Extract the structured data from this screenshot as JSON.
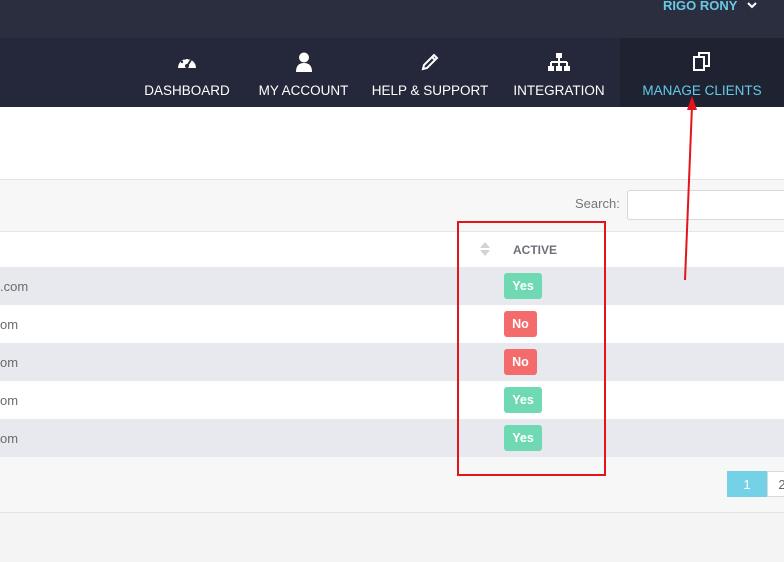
{
  "topbar": {
    "user_name": "RIGO RONY"
  },
  "nav": {
    "items": [
      {
        "label": "DASHBOARD",
        "icon": "speedometer-icon"
      },
      {
        "label": "MY ACCOUNT",
        "icon": "user-icon"
      },
      {
        "label": "HELP & SUPPORT",
        "icon": "pencil-icon"
      },
      {
        "label": "INTEGRATION",
        "icon": "sitemap-icon"
      },
      {
        "label": "MANAGE CLIENTS",
        "icon": "copy-icon",
        "active": true
      }
    ]
  },
  "search": {
    "label": "Search:",
    "value": ""
  },
  "table": {
    "columns": {
      "active": "ACTIVE"
    },
    "rows": [
      {
        "email": ".com",
        "active": "Yes"
      },
      {
        "email": "om",
        "active": "No"
      },
      {
        "email": "om",
        "active": "No"
      },
      {
        "email": "om",
        "active": "Yes"
      },
      {
        "email": "om",
        "active": "Yes"
      }
    ]
  },
  "pagination": {
    "current": "1",
    "next": "2"
  },
  "colors": {
    "topbar": "#2b2e3e",
    "nav": "#25283a",
    "accent": "#66cbe8",
    "yes_badge": "#6ed9b3",
    "no_badge": "#f46b6b",
    "annotation": "#e4141b"
  }
}
